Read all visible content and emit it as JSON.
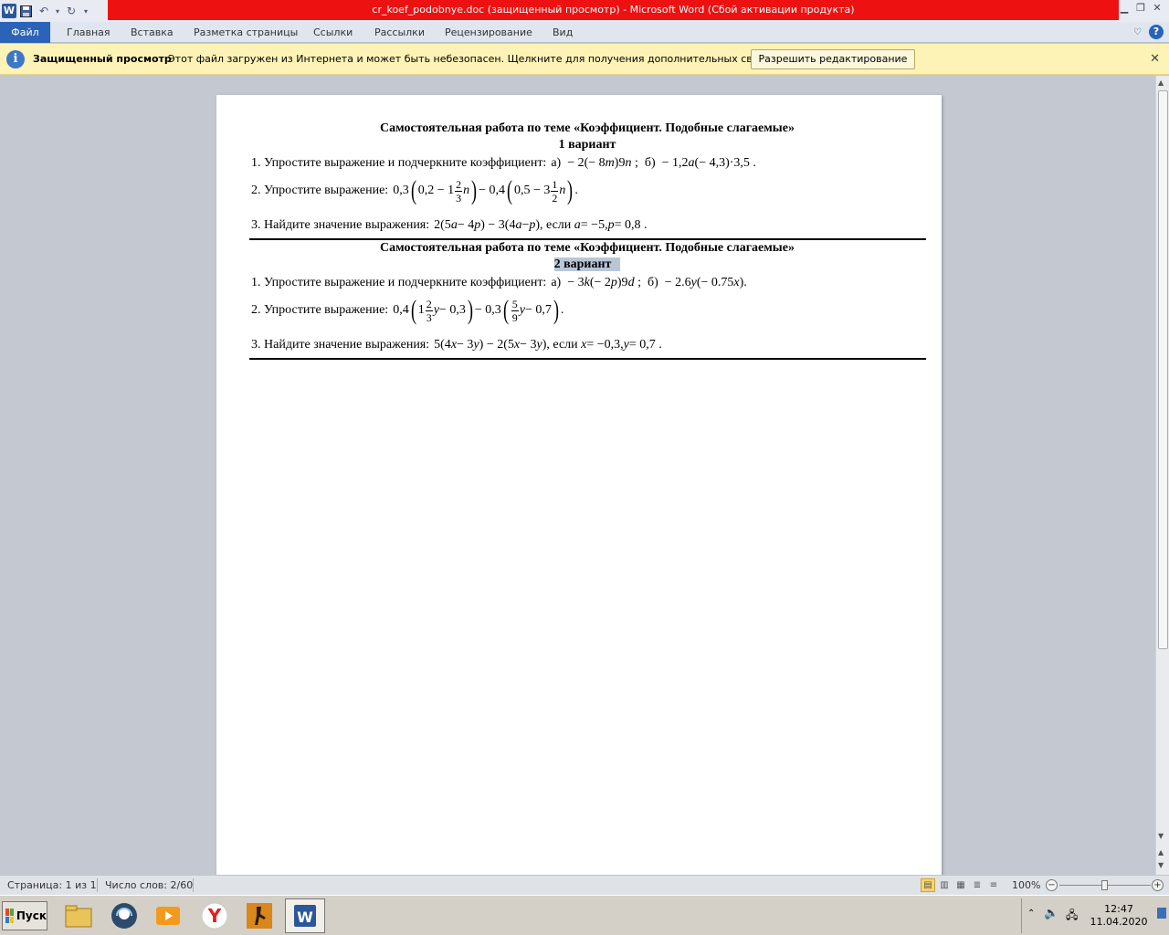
{
  "window": {
    "title": "cr_koef_podobnye.doc (защищенный просмотр) - Microsoft Word (Сбой активации продукта)"
  },
  "ribbon": {
    "tabs": [
      "Файл",
      "Главная",
      "Вставка",
      "Разметка страницы",
      "Ссылки",
      "Рассылки",
      "Рецензирование",
      "Вид"
    ]
  },
  "protected_view": {
    "title": "Защищенный просмотр",
    "message": "Этот файл загружен из Интернета и может быть небезопасен. Щелкните для получения дополнительных сведений.",
    "button": "Разрешить редактирование"
  },
  "document": {
    "variant1": {
      "heading": "Самостоятельная работа по теме «Коэффициент. Подобные слагаемые»",
      "title": "1 вариант",
      "task1_label": "1. Упростите выражение и подчеркните коэффициент:",
      "task2_label": "2. Упростите выражение:",
      "task3_label": "3. Найдите значение выражения:"
    },
    "variant2": {
      "heading": "Самостоятельная работа по теме «Коэффициент. Подобные слагаемые»",
      "title": "2 вариант",
      "task1_label": "1. Упростите выражение и подчеркните коэффициент:",
      "task2_label": "2. Упростите выражение:",
      "task3_label": "3. Найдите значение выражения:"
    }
  },
  "statusbar": {
    "page": "Страница: 1 из 1",
    "words": "Число слов: 2/60",
    "zoom": "100%"
  },
  "taskbar": {
    "start": "Пуск",
    "time": "12:47",
    "date": "11.04.2020"
  },
  "colors": {
    "title_bar": "#ee1111",
    "file_tab": "#2a63b7",
    "protected_bar": "#fdf3b6",
    "selection": "#b8c6d8"
  }
}
